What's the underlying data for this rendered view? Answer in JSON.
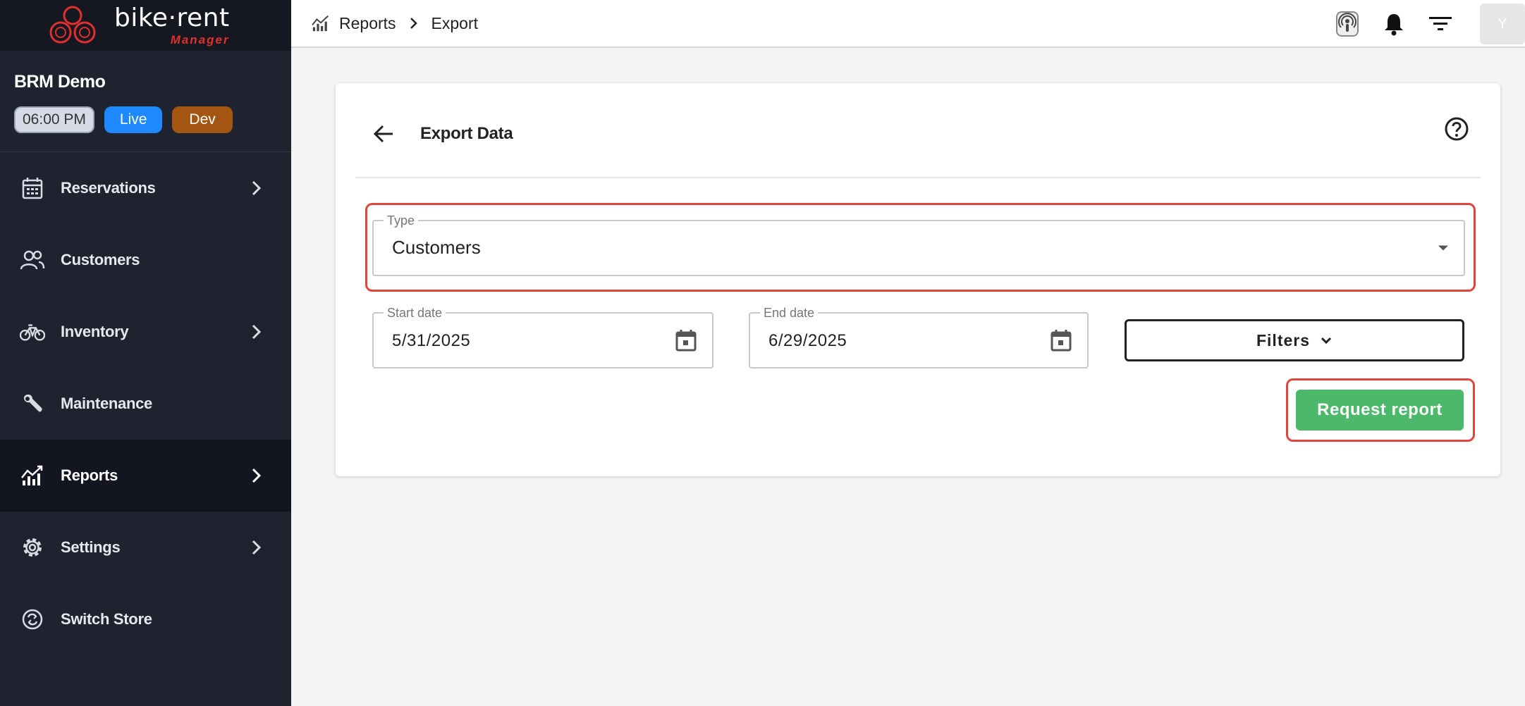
{
  "brand": {
    "name": "bike·rent",
    "subtitle": "Manager",
    "accent": "#e0302e"
  },
  "store": {
    "name": "BRM Demo",
    "time": "06:00 PM",
    "live_label": "Live",
    "dev_label": "Dev"
  },
  "sidebar": {
    "items": [
      {
        "label": "Reservations",
        "icon": "calendar-icon",
        "has_chevron": true,
        "active": false
      },
      {
        "label": "Customers",
        "icon": "users-icon",
        "has_chevron": false,
        "active": false
      },
      {
        "label": "Inventory",
        "icon": "bike-icon",
        "has_chevron": true,
        "active": false
      },
      {
        "label": "Maintenance",
        "icon": "wrench-icon",
        "has_chevron": false,
        "active": false
      },
      {
        "label": "Reports",
        "icon": "chart-icon",
        "has_chevron": true,
        "active": true
      },
      {
        "label": "Settings",
        "icon": "gear-icon",
        "has_chevron": true,
        "active": false
      },
      {
        "label": "Switch Store",
        "icon": "switch-icon",
        "has_chevron": false,
        "active": false
      }
    ]
  },
  "breadcrumb": {
    "parent": "Reports",
    "current": "Export"
  },
  "topbar": {
    "avatar_initial": "Y"
  },
  "card": {
    "title": "Export Data"
  },
  "form": {
    "type": {
      "legend": "Type",
      "value": "Customers"
    },
    "start_date": {
      "legend": "Start date",
      "value": "5/31/2025"
    },
    "end_date": {
      "legend": "End date",
      "value": "6/29/2025"
    },
    "filters_label": "Filters",
    "request_label": "Request report"
  },
  "colors": {
    "sidebar_bg": "#1f2330",
    "live": "#1e88ff",
    "dev": "#a25612",
    "request": "#4cb86a",
    "highlight": "#e0453c"
  }
}
